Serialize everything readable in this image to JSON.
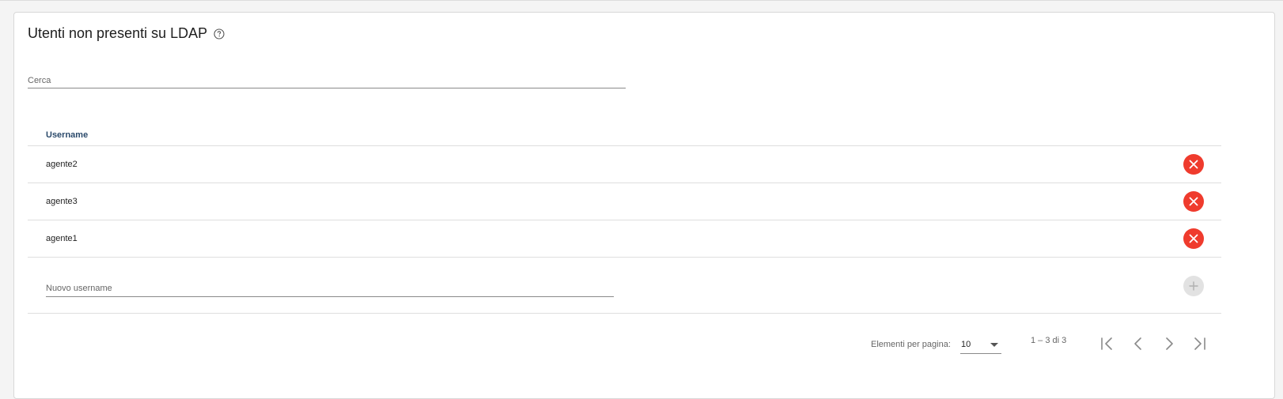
{
  "section": {
    "title": "Utenti non presenti su LDAP"
  },
  "search": {
    "placeholder": "Cerca",
    "value": ""
  },
  "table": {
    "column_header": "Username",
    "rows": [
      "agente2",
      "agente3",
      "agente1"
    ],
    "new_username_placeholder": "Nuovo username"
  },
  "paginator": {
    "items_per_page_label": "Elementi per pagina:",
    "items_per_page_value": "10",
    "range_label": "1 – 3 di 3"
  },
  "icons": {
    "help": "help-circle-icon",
    "delete": "close-icon",
    "add": "plus-icon",
    "first": "first-page-icon",
    "prev": "chevron-left-icon",
    "next": "chevron-right-icon",
    "last": "last-page-icon"
  },
  "colors": {
    "delete_button": "#ef3b2d",
    "add_button_disabled": "#e2e2e2",
    "header_text": "#2b4a6b"
  }
}
